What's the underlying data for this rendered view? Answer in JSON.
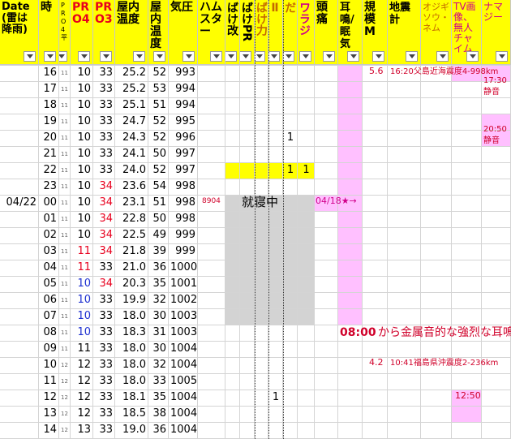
{
  "headers": [
    {
      "key": "date",
      "label": "Date\n(雷は\n降雨)",
      "style": "date"
    },
    {
      "key": "hour",
      "label": "時",
      "style": "normal"
    },
    {
      "key": "pr",
      "label": "P R O 4 平",
      "style": "small"
    },
    {
      "key": "pro4",
      "label": "PR\nO4",
      "style": "red"
    },
    {
      "key": "pro3",
      "label": "PR\nO3",
      "style": "red"
    },
    {
      "key": "temp",
      "label": "屋内\n温度",
      "style": "normal"
    },
    {
      "key": "hum",
      "label": "屋内\n温度",
      "style": "normal"
    },
    {
      "key": "press",
      "label": "気圧",
      "style": "normal"
    },
    {
      "key": "ham",
      "label": "ハム\nスター",
      "style": "normal"
    },
    {
      "key": "b1",
      "label": "ばけ改",
      "style": "vert"
    },
    {
      "key": "b2",
      "label": "ばけPR",
      "style": "vert"
    },
    {
      "key": "b3",
      "label": "ばけ力",
      "style": "vert-orange"
    },
    {
      "key": "b4",
      "label": "ばけ桜Ⅱ",
      "style": "vert-orange"
    },
    {
      "key": "b5",
      "label": "まもりだ",
      "style": "vert-orange"
    },
    {
      "key": "b6",
      "label": "ワラジ",
      "style": "vert-mag"
    },
    {
      "key": "head",
      "label": "頭痛",
      "style": "normal"
    },
    {
      "key": "ear",
      "label": "耳鳴/眠気",
      "style": "normal"
    },
    {
      "key": "scale",
      "label": "規\n模\nM",
      "style": "normal"
    },
    {
      "key": "eq",
      "label": "地震計",
      "style": "normal"
    },
    {
      "key": "ojizou",
      "label": "オジギソウ・ネム",
      "style": "orange-sm"
    },
    {
      "key": "tv",
      "label": "TV画像、無人チャイム",
      "style": "mag"
    },
    {
      "key": "namaz",
      "label": "ナマジー",
      "style": "mag"
    }
  ],
  "rows": [
    {
      "date": "",
      "hour": "16",
      "pr": "11",
      "pro4": "10",
      "pro3": "33",
      "temp": "25.2",
      "hum": "52",
      "press": "993"
    },
    {
      "date": "",
      "hour": "17",
      "pr": "11",
      "pro4": "10",
      "pro3": "33",
      "temp": "25.2",
      "hum": "53",
      "press": "994"
    },
    {
      "date": "",
      "hour": "18",
      "pr": "11",
      "pro4": "10",
      "pro3": "33",
      "temp": "25.1",
      "hum": "51",
      "press": "994"
    },
    {
      "date": "",
      "hour": "19",
      "pr": "11",
      "pro4": "10",
      "pro3": "33",
      "temp": "24.7",
      "hum": "52",
      "press": "995"
    },
    {
      "date": "",
      "hour": "20",
      "pr": "11",
      "pro4": "10",
      "pro3": "33",
      "temp": "24.3",
      "hum": "52",
      "press": "996"
    },
    {
      "date": "",
      "hour": "21",
      "pr": "11",
      "pro4": "10",
      "pro3": "33",
      "temp": "24.1",
      "hum": "50",
      "press": "997"
    },
    {
      "date": "",
      "hour": "22",
      "pr": "11",
      "pro4": "10",
      "pro3": "33",
      "temp": "24.0",
      "hum": "52",
      "press": "997"
    },
    {
      "date": "",
      "hour": "23",
      "pr": "11",
      "pro4": "10",
      "pro3": "34",
      "temp": "23.6",
      "hum": "54",
      "press": "998"
    },
    {
      "date": "04/22",
      "hour": "00",
      "pr": "11",
      "pro4": "10",
      "pro3": "34",
      "temp": "23.1",
      "hum": "51",
      "press": "998"
    },
    {
      "date": "",
      "hour": "01",
      "pr": "11",
      "pro4": "10",
      "pro3": "34",
      "temp": "22.8",
      "hum": "50",
      "press": "998"
    },
    {
      "date": "",
      "hour": "02",
      "pr": "11",
      "pro4": "10",
      "pro3": "34",
      "temp": "22.5",
      "hum": "49",
      "press": "999"
    },
    {
      "date": "",
      "hour": "03",
      "pr": "11",
      "pro4": "11",
      "pro3": "34",
      "temp": "21.8",
      "hum": "39",
      "press": "999"
    },
    {
      "date": "",
      "hour": "04",
      "pr": "11",
      "pro4": "11",
      "pro3": "33",
      "temp": "21.0",
      "hum": "36",
      "press": "1000"
    },
    {
      "date": "",
      "hour": "05",
      "pr": "11",
      "pro4": "10",
      "pro3": "34",
      "temp": "20.3",
      "hum": "35",
      "press": "1001"
    },
    {
      "date": "",
      "hour": "06",
      "pr": "11",
      "pro4": "10",
      "pro3": "33",
      "temp": "19.9",
      "hum": "32",
      "press": "1002"
    },
    {
      "date": "",
      "hour": "07",
      "pr": "11",
      "pro4": "10",
      "pro3": "33",
      "temp": "18.0",
      "hum": "30",
      "press": "1003"
    },
    {
      "date": "",
      "hour": "08",
      "pr": "11",
      "pro4": "10",
      "pro3": "33",
      "temp": "18.3",
      "hum": "31",
      "press": "1003"
    },
    {
      "date": "",
      "hour": "09",
      "pr": "11",
      "pro4": "11",
      "pro3": "33",
      "temp": "18.0",
      "hum": "30",
      "press": "1004"
    },
    {
      "date": "",
      "hour": "10",
      "pr": "12",
      "pro4": "12",
      "pro3": "33",
      "temp": "18.0",
      "hum": "32",
      "press": "1004"
    },
    {
      "date": "",
      "hour": "11",
      "pr": "12",
      "pro4": "12",
      "pro3": "33",
      "temp": "18.0",
      "hum": "33",
      "press": "1005"
    },
    {
      "date": "",
      "hour": "12",
      "pr": "12",
      "pro4": "12",
      "pro3": "33",
      "temp": "18.1",
      "hum": "35",
      "press": "1004"
    },
    {
      "date": "",
      "hour": "13",
      "pr": "12",
      "pro4": "12",
      "pro3": "33",
      "temp": "18.5",
      "hum": "38",
      "press": "1004"
    },
    {
      "date": "",
      "hour": "14",
      "pr": "12",
      "pro4": "13",
      "pro3": "33",
      "temp": "19.0",
      "hum": "36",
      "press": "1004"
    }
  ],
  "extra_values": [
    {
      "row": 4,
      "col": "b5",
      "text": "1"
    },
    {
      "row": 6,
      "col": "b5",
      "text": "1"
    },
    {
      "row": 6,
      "col": "b6",
      "text": "1"
    },
    {
      "row": 20,
      "col": "b4",
      "text": "1"
    }
  ],
  "notes": {
    "quake1_scale": "5.6",
    "quake1_text": "16:20父島近海震度4-998km",
    "tv1": "17:30",
    "tv1b": "静音",
    "tv2": "20:50",
    "tv2b": "静音",
    "hamster_val": "8904",
    "sleeping": "就寝中",
    "ear_arrow": "04/18★→",
    "tinnitus_time": "08:00",
    "tinnitus_text": "から金属音的な強烈な耳鳴り",
    "quake2_scale": "4.2",
    "quake2_text": "10:41福島県沖震度2-236km",
    "chime_time": "12:50"
  },
  "colors": {
    "header_bg": "#ffff00",
    "red": "#e8001e",
    "blue": "#1c2fd0",
    "pink": "#ffc0ff",
    "gray": "#d3d3d3",
    "yellow": "#ffff00"
  }
}
